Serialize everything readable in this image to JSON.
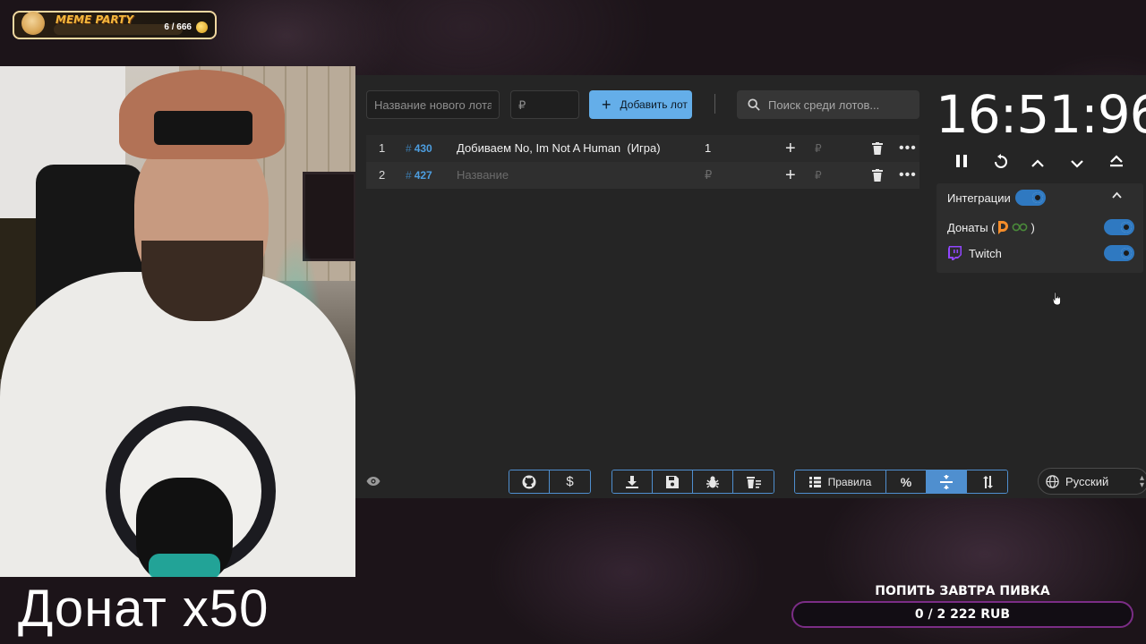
{
  "overlay": {
    "badge_title": "MEME PARTY",
    "badge_count": "6 / 666",
    "donation_caption": "Донат x50",
    "goal_title": "ПОПИТЬ ЗАВТРА ПИВКА",
    "goal_progress": "0 / 2 222 RUB"
  },
  "toolbar": {
    "lot_name_placeholder": "Название нового лота",
    "amount_placeholder": "₽",
    "add_label": "Добавить лот",
    "search_placeholder": "Поиск среди лотов..."
  },
  "lots": [
    {
      "index": "1",
      "id_hash": "#",
      "id": "430",
      "name": "Добиваем No, Im Not A Human  (Игра)",
      "amount": "1",
      "add": "+",
      "currency": "₽",
      "more": "•••"
    },
    {
      "index": "2",
      "id_hash": "#",
      "id": "427",
      "name": "Название",
      "amount": "₽",
      "add": "+",
      "currency": "₽",
      "more": "•••"
    }
  ],
  "timer": {
    "value": "16:51:96"
  },
  "integrations": {
    "label": "Интеграции",
    "donations_label": "Донаты (",
    "donations_suffix": ")",
    "twitch_label": "Twitch",
    "enabled": true
  },
  "bottom_bar": {
    "rules_label": "Правила",
    "percent_label": "%",
    "language": "Русский"
  },
  "colors": {
    "accent": "#64aee9",
    "toggle": "#2f79c1",
    "id_link": "#4d9ee0",
    "panel_bg": "#252525",
    "goal_border": "#7b2d86",
    "twitch": "#9146ff"
  },
  "icons": [
    "github-icon",
    "dollar-icon",
    "download-icon",
    "save-icon",
    "bug-icon",
    "trash-list-icon",
    "rules-list-icon",
    "percent-icon",
    "compress-icon",
    "sort-icon",
    "globe-icon",
    "eye-icon",
    "pause-icon",
    "restart-icon",
    "chevron-up-icon",
    "chevron-down-icon",
    "eject-icon"
  ]
}
